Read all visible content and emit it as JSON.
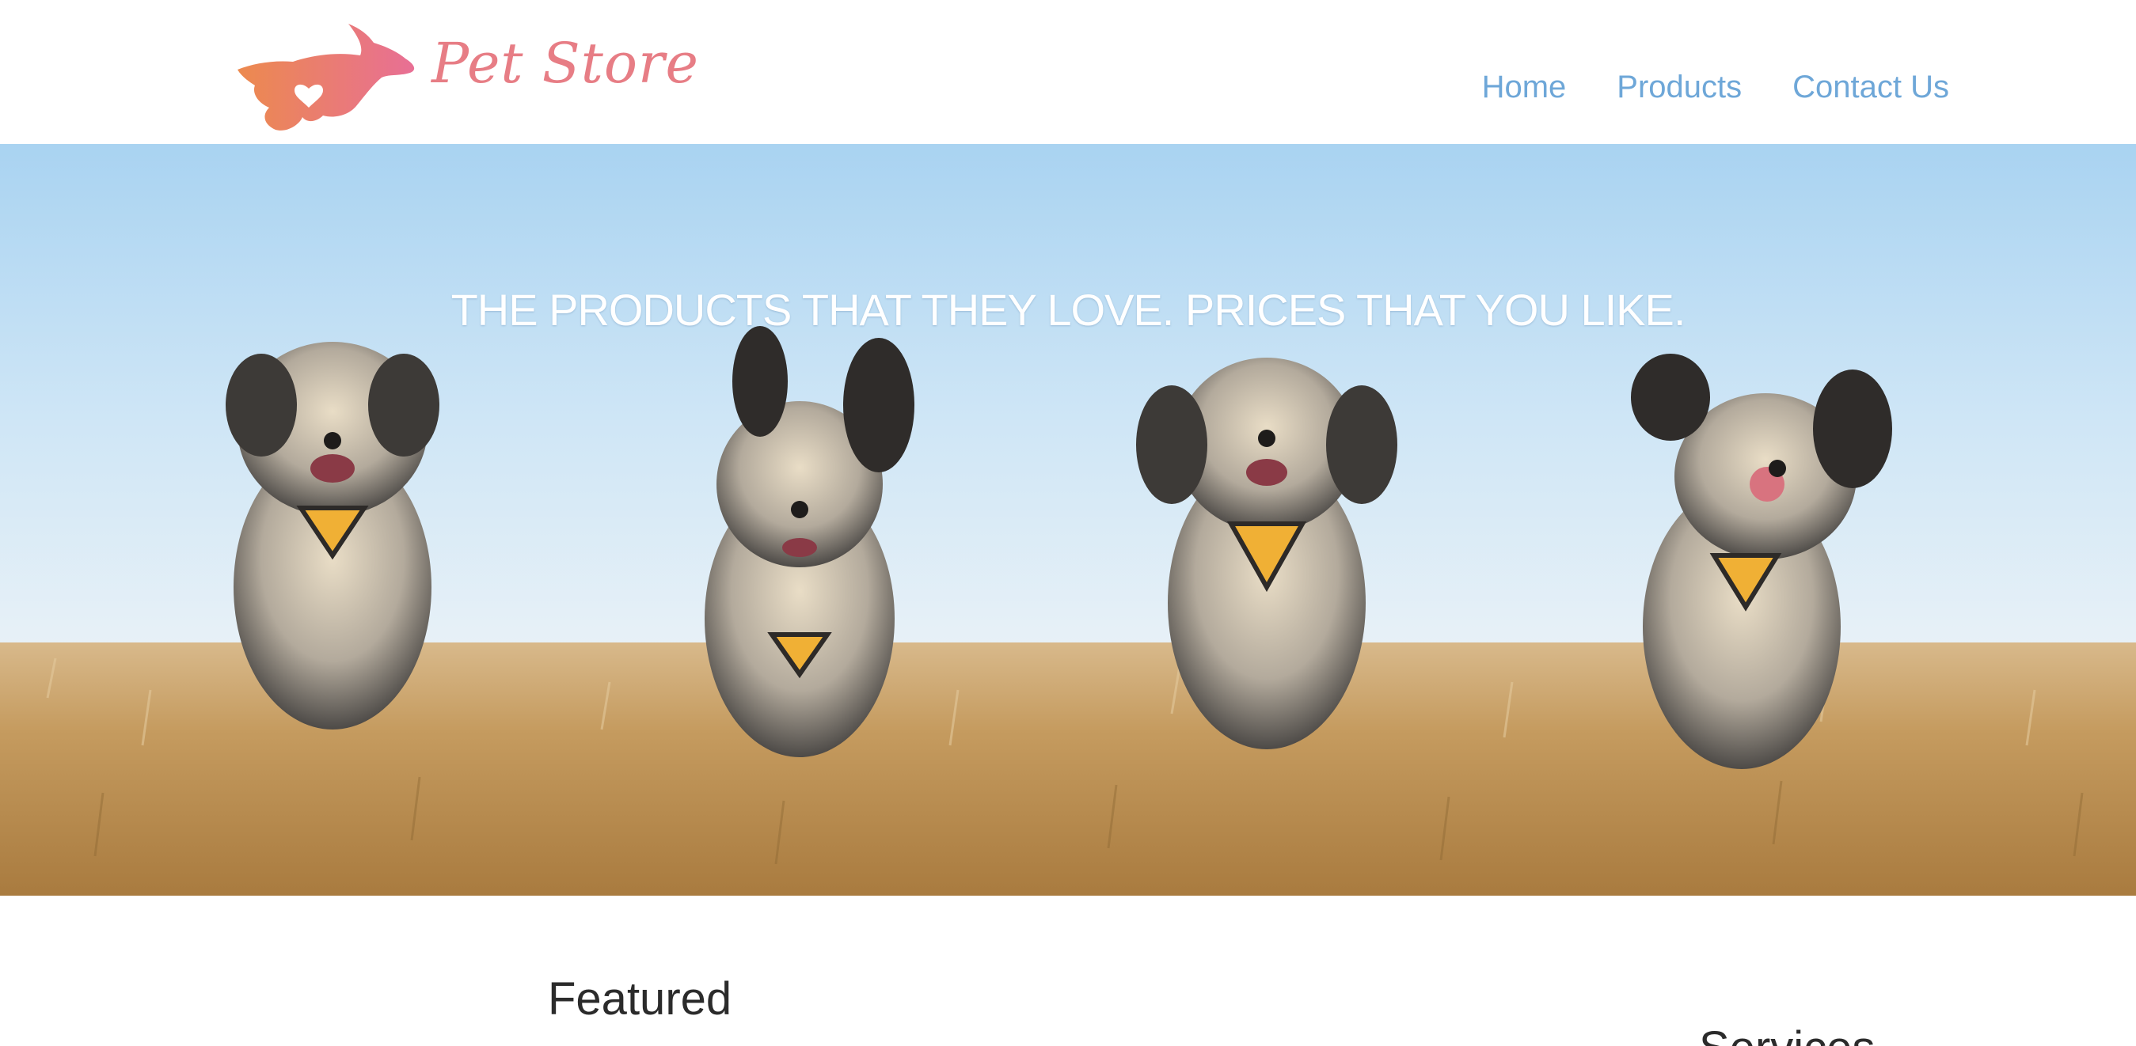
{
  "header": {
    "logo_text": "Pet Store",
    "nav": [
      {
        "label": "Home"
      },
      {
        "label": "Products"
      },
      {
        "label": "Contact Us"
      }
    ]
  },
  "hero": {
    "tagline": "THE PRODUCTS THAT THEY LOVE. PRICES THAT YOU LIKE."
  },
  "main": {
    "featured_heading": "Featured",
    "services_heading": "Services"
  },
  "colors": {
    "brand_pink": "#e77d85",
    "brand_orange": "#ec8a4e",
    "nav_link": "#6ea7d8",
    "heading_text": "#2b2b2b"
  },
  "icons": {
    "logo": "running-dog-heart-icon"
  }
}
